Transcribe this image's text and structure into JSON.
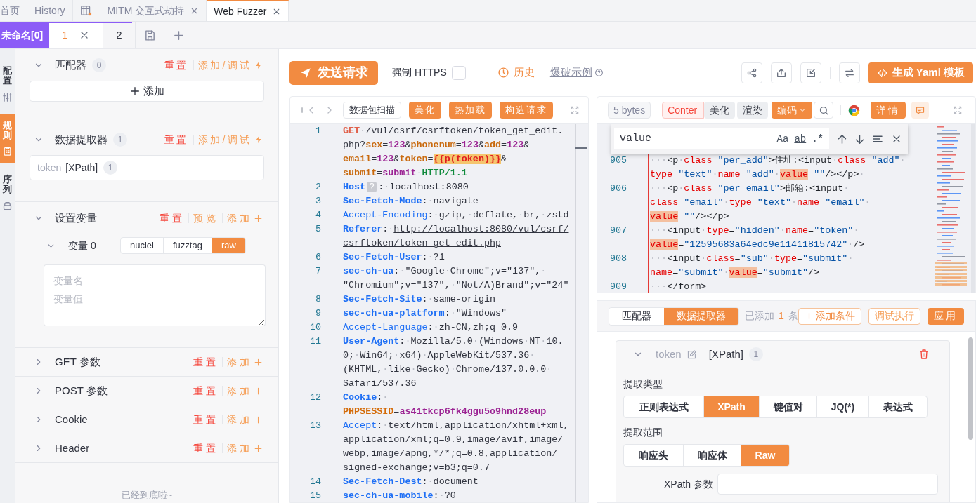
{
  "top_tabs": [
    {
      "kind": "text",
      "label": "首页",
      "closable": false,
      "selected": false
    },
    {
      "kind": "text",
      "label": "History",
      "closable": false,
      "selected": false
    },
    {
      "kind": "icon",
      "closable": false,
      "selected": false
    },
    {
      "kind": "text",
      "label": "MITM 交互式劫持",
      "closable": true,
      "selected": false
    },
    {
      "kind": "text",
      "label": "Web Fuzzer",
      "closable": true,
      "selected": true
    }
  ],
  "sub_tabs": {
    "group_label": "未命名[0]",
    "items": [
      {
        "label": "1",
        "closable": true,
        "selected": true
      },
      {
        "label": "2",
        "closable": false,
        "selected": false
      }
    ]
  },
  "side_rail": [
    {
      "label": "配置",
      "selected": false
    },
    {
      "label": "规则",
      "selected": true
    },
    {
      "label": "序列",
      "selected": false
    }
  ],
  "left_panel": {
    "sections": [
      {
        "kind": "matcher",
        "title": "匹配器",
        "count": "0",
        "expanded": true,
        "actions": [
          {
            "kind": "reset",
            "label": "重置"
          },
          {
            "kind": "add_debug",
            "label": "添加/调试"
          }
        ],
        "add_button": "添加"
      },
      {
        "kind": "extractor",
        "title": "数据提取器",
        "count": "1",
        "expanded": true,
        "actions": [
          {
            "kind": "reset",
            "label": "重置"
          },
          {
            "kind": "add_debug",
            "label": "添加/调试"
          }
        ],
        "item": {
          "name": "token",
          "type": "[XPath]",
          "count": "1"
        }
      },
      {
        "kind": "variables",
        "title": "设置变量",
        "expanded": true,
        "actions": [
          {
            "kind": "reset",
            "label": "重置"
          },
          {
            "kind": "preview",
            "label": "预览"
          },
          {
            "kind": "add",
            "label": "添加"
          }
        ],
        "variable": {
          "label": "变量 0",
          "expanded": true,
          "modes": [
            {
              "label": "nuclei",
              "selected": false
            },
            {
              "label": "fuzztag",
              "selected": false
            },
            {
              "label": "raw",
              "selected": true
            }
          ],
          "name_placeholder": "变量名",
          "value_placeholder": "变量值"
        }
      },
      {
        "kind": "simple",
        "title": "GET 参数",
        "expanded": false,
        "actions": [
          {
            "kind": "reset",
            "label": "重置"
          },
          {
            "kind": "add",
            "label": "添加"
          }
        ]
      },
      {
        "kind": "simple",
        "title": "POST 参数",
        "expanded": false,
        "actions": [
          {
            "kind": "reset",
            "label": "重置"
          },
          {
            "kind": "add",
            "label": "添加"
          }
        ]
      },
      {
        "kind": "simple",
        "title": "Cookie",
        "expanded": false,
        "actions": [
          {
            "kind": "reset",
            "label": "重置"
          },
          {
            "kind": "add",
            "label": "添加"
          }
        ]
      },
      {
        "kind": "simple",
        "title": "Header",
        "expanded": false,
        "actions": [
          {
            "kind": "reset",
            "label": "重置"
          },
          {
            "kind": "add",
            "label": "添加"
          }
        ]
      }
    ],
    "footer": "已经到底啦~"
  },
  "toolbar": {
    "send_button": "发送请求",
    "force_https": {
      "label": "强制 HTTPS",
      "checked": false
    },
    "history": "历史",
    "example_link": "爆破示例",
    "yaml_button": "生成 Yaml 模板"
  },
  "request_editor": {
    "buttons": [
      {
        "kind": "outline",
        "label": "数据包扫描"
      },
      {
        "kind": "primary",
        "label": "美化"
      },
      {
        "kind": "primary",
        "label": "热加载"
      },
      {
        "kind": "primary",
        "label": "构造请求"
      }
    ],
    "lines": [
      {
        "number": "1",
        "rows": [
          {
            "segments": [
              {
                "kind": "method",
                "text": "GET"
              },
              {
                "kind": "plain",
                "text": "·/vul/csrf/csrftoken/token_get_edit."
              }
            ]
          },
          {
            "segments": [
              {
                "kind": "plain",
                "text": "php?"
              },
              {
                "kind": "param",
                "text": "sex"
              },
              {
                "kind": "plain",
                "text": "="
              },
              {
                "kind": "pval",
                "text": "123"
              },
              {
                "kind": "plain",
                "text": "&"
              },
              {
                "kind": "param",
                "text": "phonenum"
              },
              {
                "kind": "plain",
                "text": "="
              },
              {
                "kind": "pval",
                "text": "123"
              },
              {
                "kind": "plain",
                "text": "&"
              },
              {
                "kind": "param",
                "text": "add"
              },
              {
                "kind": "plain",
                "text": "="
              },
              {
                "kind": "pval",
                "text": "123"
              },
              {
                "kind": "plain",
                "text": "&"
              }
            ]
          },
          {
            "segments": [
              {
                "kind": "param",
                "text": "email"
              },
              {
                "kind": "plain",
                "text": "="
              },
              {
                "kind": "pval",
                "text": "123"
              },
              {
                "kind": "plain",
                "text": "&"
              },
              {
                "kind": "param",
                "text": "token"
              },
              {
                "kind": "plain",
                "text": "="
              },
              {
                "kind": "fuzz",
                "text": "{{p(token)}}"
              },
              {
                "kind": "plain",
                "text": "&"
              }
            ]
          },
          {
            "segments": [
              {
                "kind": "param",
                "text": "submit"
              },
              {
                "kind": "plain",
                "text": "="
              },
              {
                "kind": "pval",
                "text": "submit"
              },
              {
                "kind": "plain",
                "text": "·"
              },
              {
                "kind": "version",
                "text": "HTTP/1.1"
              }
            ]
          }
        ]
      },
      {
        "number": "2",
        "rows": [
          {
            "segments": [
              {
                "kind": "hkey",
                "text": "Host"
              },
              {
                "kind": "badge",
                "text": "?"
              },
              {
                "kind": "plain",
                "text": ":·localhost:8080"
              }
            ]
          }
        ]
      },
      {
        "number": "3",
        "rows": [
          {
            "segments": [
              {
                "kind": "hkey",
                "text": "Sec-Fetch-Mode"
              },
              {
                "kind": "plain",
                "text": ":·navigate"
              }
            ]
          }
        ]
      },
      {
        "number": "4",
        "rows": [
          {
            "segments": [
              {
                "kind": "hkey2",
                "text": "Accept-Encoding"
              },
              {
                "kind": "plain",
                "text": ":·gzip,·deflate,·br,·zstd"
              }
            ]
          }
        ]
      },
      {
        "number": "5",
        "rows": [
          {
            "segments": [
              {
                "kind": "hkey",
                "text": "Referer"
              },
              {
                "kind": "plain",
                "text": ":·"
              },
              {
                "kind": "link",
                "text": "http://localhost:8080/vul/csrf/"
              }
            ]
          },
          {
            "segments": [
              {
                "kind": "link",
                "text": "csrftoken/token_get_edit.php"
              }
            ]
          }
        ]
      },
      {
        "number": "6",
        "rows": [
          {
            "segments": [
              {
                "kind": "hkey",
                "text": "Sec-Fetch-User"
              },
              {
                "kind": "plain",
                "text": ":·?1"
              }
            ]
          }
        ]
      },
      {
        "number": "7",
        "rows": [
          {
            "segments": [
              {
                "kind": "hkey",
                "text": "sec-ch-ua"
              },
              {
                "kind": "plain",
                "text": ":·\"Google·Chrome\";v=\"137\",·"
              }
            ]
          },
          {
            "segments": [
              {
                "kind": "plain",
                "text": "\"Chromium\";v=\"137\",·\"Not/A)Brand\";v=\"24\""
              }
            ]
          }
        ]
      },
      {
        "number": "8",
        "rows": [
          {
            "segments": [
              {
                "kind": "hkey",
                "text": "Sec-Fetch-Site"
              },
              {
                "kind": "plain",
                "text": ":·same-origin"
              }
            ]
          }
        ]
      },
      {
        "number": "9",
        "rows": [
          {
            "segments": [
              {
                "kind": "hkey",
                "text": "sec-ch-ua-platform"
              },
              {
                "kind": "plain",
                "text": ":·\"Windows\""
              }
            ]
          }
        ]
      },
      {
        "number": "10",
        "rows": [
          {
            "segments": [
              {
                "kind": "hkey2",
                "text": "Accept-Language"
              },
              {
                "kind": "plain",
                "text": ":·zh-CN,zh;q=0.9"
              }
            ]
          }
        ]
      },
      {
        "number": "11",
        "rows": [
          {
            "segments": [
              {
                "kind": "hkey",
                "text": "User-Agent"
              },
              {
                "kind": "plain",
                "text": ":·Mozilla/5.0·(Windows·NT·10."
              }
            ]
          },
          {
            "segments": [
              {
                "kind": "plain",
                "text": "0;·Win64;·x64)·AppleWebKit/537.36·"
              }
            ]
          },
          {
            "segments": [
              {
                "kind": "plain",
                "text": "(KHTML,·like·Gecko)·Chrome/137.0.0.0·"
              }
            ]
          },
          {
            "segments": [
              {
                "kind": "plain",
                "text": "Safari/537.36"
              }
            ]
          }
        ]
      },
      {
        "number": "12",
        "rows": [
          {
            "segments": [
              {
                "kind": "hkey",
                "text": "Cookie"
              },
              {
                "kind": "plain",
                "text": ":·"
              }
            ]
          },
          {
            "segments": [
              {
                "kind": "ckey",
                "text": "PHPSESSID"
              },
              {
                "kind": "plain",
                "text": "="
              },
              {
                "kind": "cval",
                "text": "as41tkcp6fk4ggu5o9hnd28eup"
              }
            ]
          }
        ]
      },
      {
        "number": "13",
        "rows": [
          {
            "segments": [
              {
                "kind": "hkey2",
                "text": "Accept"
              },
              {
                "kind": "plain",
                "text": ":·text/html,application/xhtml+xml,"
              }
            ]
          },
          {
            "segments": [
              {
                "kind": "plain",
                "text": "application/xml;q=0.9,image/avif,image/"
              }
            ]
          },
          {
            "segments": [
              {
                "kind": "plain",
                "text": "webp,image/apng,*/*;q=0.8,application/"
              }
            ]
          },
          {
            "segments": [
              {
                "kind": "plain",
                "text": "signed-exchange;v=b3;q=0.7"
              }
            ]
          }
        ]
      },
      {
        "number": "14",
        "rows": [
          {
            "segments": [
              {
                "kind": "hkey",
                "text": "Sec-Fetch-Dest"
              },
              {
                "kind": "plain",
                "text": ":·document"
              }
            ]
          }
        ]
      },
      {
        "number": "15",
        "rows": [
          {
            "segments": [
              {
                "kind": "hkey",
                "text": "sec-ch-ua-mobile"
              },
              {
                "kind": "plain",
                "text": ":·?0"
              }
            ]
          }
        ]
      }
    ]
  },
  "response": {
    "size_tag": "5 bytes",
    "content_tag": "Conter",
    "buttons": [
      {
        "kind": "gray",
        "label": "美化"
      },
      {
        "kind": "gray",
        "label": "渲染"
      },
      {
        "kind": "dropdown",
        "label": "编码"
      }
    ],
    "detail_button": "详情",
    "search": {
      "value": "value",
      "options": [
        "Aa",
        "ab",
        ".*"
      ]
    },
    "lines": [
      {
        "number": "905",
        "rows": [
          {
            "segments": [
              {
                "kind": "tag",
                "text": "···<p·"
              },
              {
                "kind": "attr",
                "text": "class"
              },
              {
                "kind": "tag",
                "text": "="
              },
              {
                "kind": "str",
                "text": "\"per_add\""
              },
              {
                "kind": "tag",
                "text": ">住址:<input·"
              },
              {
                "kind": "attr",
                "text": "class"
              },
              {
                "kind": "tag",
                "text": "="
              },
              {
                "kind": "str",
                "text": "\"add\""
              },
              {
                "kind": "tag",
                "text": "·"
              }
            ]
          },
          {
            "segments": [
              {
                "kind": "attr",
                "text": "type"
              },
              {
                "kind": "tag",
                "text": "="
              },
              {
                "kind": "str",
                "text": "\"text\""
              },
              {
                "kind": "tag",
                "text": "·"
              },
              {
                "kind": "attr",
                "text": "name"
              },
              {
                "kind": "tag",
                "text": "="
              },
              {
                "kind": "str",
                "text": "\"add\""
              },
              {
                "kind": "tag",
                "text": "·"
              },
              {
                "kind": "hl",
                "text": "value"
              },
              {
                "kind": "tag",
                "text": "="
              },
              {
                "kind": "str",
                "text": "\"\""
              },
              {
                "kind": "tag",
                "text": "/></p>·"
              }
            ]
          }
        ]
      },
      {
        "number": "906",
        "rows": [
          {
            "segments": [
              {
                "kind": "tag",
                "text": "···<p·"
              },
              {
                "kind": "attr",
                "text": "class"
              },
              {
                "kind": "tag",
                "text": "="
              },
              {
                "kind": "str",
                "text": "\"per_email\""
              },
              {
                "kind": "tag",
                "text": ">邮箱:<input·"
              }
            ]
          },
          {
            "segments": [
              {
                "kind": "attr",
                "text": "class"
              },
              {
                "kind": "tag",
                "text": "="
              },
              {
                "kind": "str",
                "text": "\"email\""
              },
              {
                "kind": "tag",
                "text": "·"
              },
              {
                "kind": "attr",
                "text": "type"
              },
              {
                "kind": "tag",
                "text": "="
              },
              {
                "kind": "str",
                "text": "\"text\""
              },
              {
                "kind": "tag",
                "text": "·"
              },
              {
                "kind": "attr",
                "text": "name"
              },
              {
                "kind": "tag",
                "text": "="
              },
              {
                "kind": "str",
                "text": "\"email\""
              },
              {
                "kind": "tag",
                "text": "·"
              }
            ]
          },
          {
            "segments": [
              {
                "kind": "hl",
                "text": "value"
              },
              {
                "kind": "tag",
                "text": "="
              },
              {
                "kind": "str",
                "text": "\"\""
              },
              {
                "kind": "tag",
                "text": "/></p>"
              }
            ]
          }
        ]
      },
      {
        "number": "907",
        "rows": [
          {
            "segments": [
              {
                "kind": "tag",
                "text": "···<input·"
              },
              {
                "kind": "attr",
                "text": "type"
              },
              {
                "kind": "tag",
                "text": "="
              },
              {
                "kind": "str",
                "text": "\"hidden\""
              },
              {
                "kind": "tag",
                "text": "·"
              },
              {
                "kind": "attr",
                "text": "name"
              },
              {
                "kind": "tag",
                "text": "="
              },
              {
                "kind": "str",
                "text": "\"token\""
              },
              {
                "kind": "tag",
                "text": "·"
              }
            ]
          },
          {
            "segments": [
              {
                "kind": "hl",
                "text": "value"
              },
              {
                "kind": "tag",
                "text": "="
              },
              {
                "kind": "str",
                "text": "\"12595683a64edc9e11411815742\""
              },
              {
                "kind": "tag",
                "text": "·/>"
              }
            ]
          }
        ]
      },
      {
        "number": "908",
        "rows": [
          {
            "segments": [
              {
                "kind": "tag",
                "text": "···<input·"
              },
              {
                "kind": "attr",
                "text": "class"
              },
              {
                "kind": "tag",
                "text": "="
              },
              {
                "kind": "str",
                "text": "\"sub\""
              },
              {
                "kind": "tag",
                "text": "·"
              },
              {
                "kind": "attr",
                "text": "type"
              },
              {
                "kind": "tag",
                "text": "="
              },
              {
                "kind": "str",
                "text": "\"submit\""
              },
              {
                "kind": "tag",
                "text": "·"
              }
            ]
          },
          {
            "segments": [
              {
                "kind": "attr",
                "text": "name"
              },
              {
                "kind": "tag",
                "text": "="
              },
              {
                "kind": "str",
                "text": "\"submit\""
              },
              {
                "kind": "tag",
                "text": "·"
              },
              {
                "kind": "hl",
                "text": "value"
              },
              {
                "kind": "tag",
                "text": "="
              },
              {
                "kind": "str",
                "text": "\"submit\""
              },
              {
                "kind": "tag",
                "text": "/>"
              }
            ]
          }
        ]
      },
      {
        "number": "909",
        "rows": [
          {
            "segments": [
              {
                "kind": "tag",
                "text": "···</form>"
              }
            ]
          }
        ]
      }
    ]
  },
  "extractor_panel": {
    "tabs": [
      {
        "label": "匹配器",
        "selected": false
      },
      {
        "label": "数据提取器",
        "selected": true
      }
    ],
    "added_prefix": "已添加",
    "added_count": "1",
    "added_suffix": "条",
    "buttons": [
      {
        "kind": "add",
        "label": "添加条件"
      },
      {
        "kind": "outline",
        "label": "调试执行"
      },
      {
        "kind": "primary",
        "label": "应用"
      }
    ],
    "item": {
      "name": "token",
      "type": "[XPath]",
      "count": "1",
      "expanded": true,
      "type_label": "提取类型",
      "types": [
        {
          "label": "正则表达式",
          "selected": false
        },
        {
          "label": "XPath",
          "selected": true
        },
        {
          "label": "键值对",
          "selected": false
        },
        {
          "label": "JQ(*)",
          "selected": false
        },
        {
          "label": "表达式",
          "selected": false
        }
      ],
      "scope_label": "提取范围",
      "scopes": [
        {
          "label": "响应头",
          "selected": false
        },
        {
          "label": "响应体",
          "selected": false
        },
        {
          "label": "Raw",
          "selected": true
        }
      ],
      "param_label": "XPath 参数"
    }
  }
}
